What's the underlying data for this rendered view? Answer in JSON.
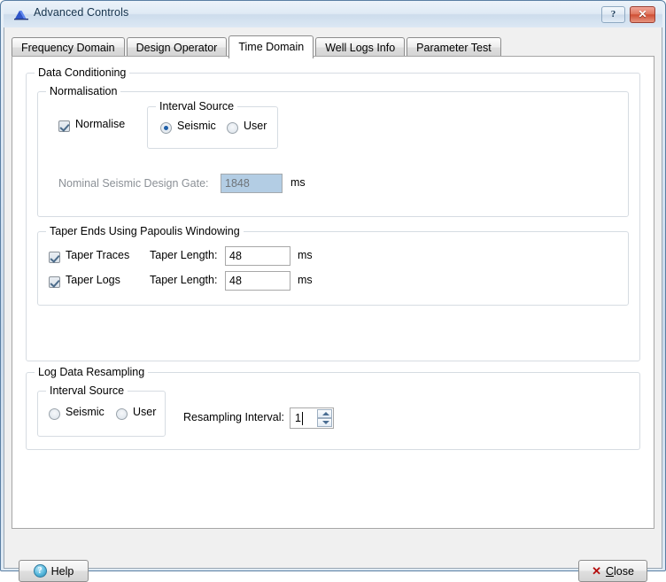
{
  "window": {
    "title": "Advanced Controls",
    "icon": "app-mountain-icon",
    "help_button_glyph": "?",
    "close_button_glyph": "✕"
  },
  "tabs": [
    {
      "label": "Frequency Domain",
      "active": false
    },
    {
      "label": "Design Operator",
      "active": false
    },
    {
      "label": "Time Domain",
      "active": true
    },
    {
      "label": "Well Logs Info",
      "active": false
    },
    {
      "label": "Parameter Test",
      "active": false
    }
  ],
  "data_conditioning": {
    "legend": "Data Conditioning",
    "normalisation": {
      "legend": "Normalisation",
      "normalise_checkbox": {
        "label": "Normalise",
        "checked": true
      },
      "interval_source": {
        "legend": "Interval Source",
        "options": [
          {
            "label": "Seismic",
            "selected": true
          },
          {
            "label": "User",
            "selected": false
          }
        ]
      },
      "nominal_gate": {
        "label": "Nominal Seismic Design Gate:",
        "value": "1848",
        "unit": "ms",
        "enabled": false
      }
    },
    "taper": {
      "legend": "Taper Ends Using Papoulis Windowing",
      "rows": [
        {
          "checkbox_label": "Taper Traces",
          "checked": true,
          "length_label": "Taper Length:",
          "length_value": "48",
          "unit": "ms"
        },
        {
          "checkbox_label": "Taper Logs",
          "checked": true,
          "length_label": "Taper Length:",
          "length_value": "48",
          "unit": "ms"
        }
      ]
    }
  },
  "log_resampling": {
    "legend": "Log Data Resampling",
    "interval_source": {
      "legend": "Interval Source",
      "options": [
        {
          "label": "Seismic",
          "selected": false
        },
        {
          "label": "User",
          "selected": true
        }
      ]
    },
    "resampling_interval": {
      "label": "Resampling Interval:",
      "value": "1"
    }
  },
  "footer": {
    "help_label": "Help",
    "close_label": "Close",
    "close_icon_glyph": "✕",
    "help_icon_glyph": "?"
  },
  "colors": {
    "titlebar_text": "#16334d",
    "disabled_field_bg": "#b3cde4",
    "close_icon": "#b40d0d",
    "radio_dot": "#1f5fa8",
    "active_tab_bg": "#ffffff"
  }
}
